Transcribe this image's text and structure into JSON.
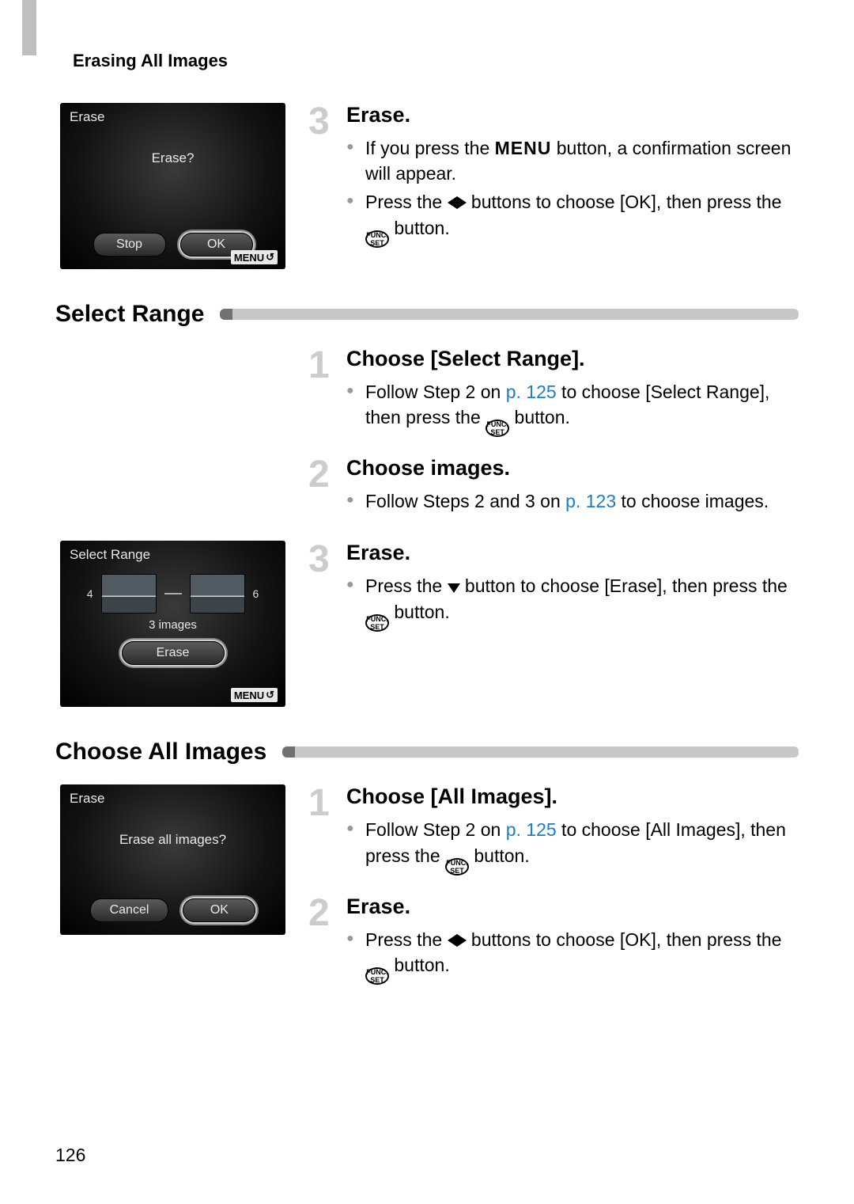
{
  "page_header": "Erasing All Images",
  "page_number": "126",
  "lcd1": {
    "title": "Erase",
    "prompt": "Erase?",
    "btn_left": "Stop",
    "btn_right": "OK",
    "menu": "MENU"
  },
  "sec1": {
    "step3": {
      "num": "3",
      "title": "Erase.",
      "b1_a": "If you press the ",
      "b1_menu": "MENU",
      "b1_b": " button, a confirmation screen will appear.",
      "b2_a": "Press the ",
      "b2_b": " buttons to choose [OK], then press the ",
      "b2_c": " button."
    }
  },
  "heading_select_range": "Select Range",
  "sr": {
    "s1": {
      "num": "1",
      "title": "Choose [Select Range].",
      "a": "Follow Step 2 on ",
      "link": "p. 125",
      "b": " to choose [Select Range], then press the ",
      "c": " button."
    },
    "s2": {
      "num": "2",
      "title": "Choose images.",
      "a": "Follow Steps 2 and 3 on ",
      "link": "p. 123",
      "b": " to choose images."
    },
    "s3": {
      "num": "3",
      "title": "Erase.",
      "a": "Press the ",
      "b": " button to choose [Erase], then press the ",
      "c": " button."
    }
  },
  "lcd2": {
    "title": "Select Range",
    "left_num": "4",
    "right_num": "6",
    "count": "3 images",
    "btn": "Erase",
    "menu": "MENU"
  },
  "heading_all": "Choose All Images",
  "lcd3": {
    "title": "Erase",
    "prompt": "Erase all images?",
    "btn_left": "Cancel",
    "btn_right": "OK"
  },
  "ai": {
    "s1": {
      "num": "1",
      "title": "Choose [All Images].",
      "a": "Follow Step 2 on ",
      "link": "p. 125",
      "b": " to choose [All Images], then press the ",
      "c": " button."
    },
    "s2": {
      "num": "2",
      "title": "Erase.",
      "a": "Press the ",
      "b": " buttons to choose [OK], then press the ",
      "c": " button."
    }
  },
  "func_set": "FUNC. SET"
}
